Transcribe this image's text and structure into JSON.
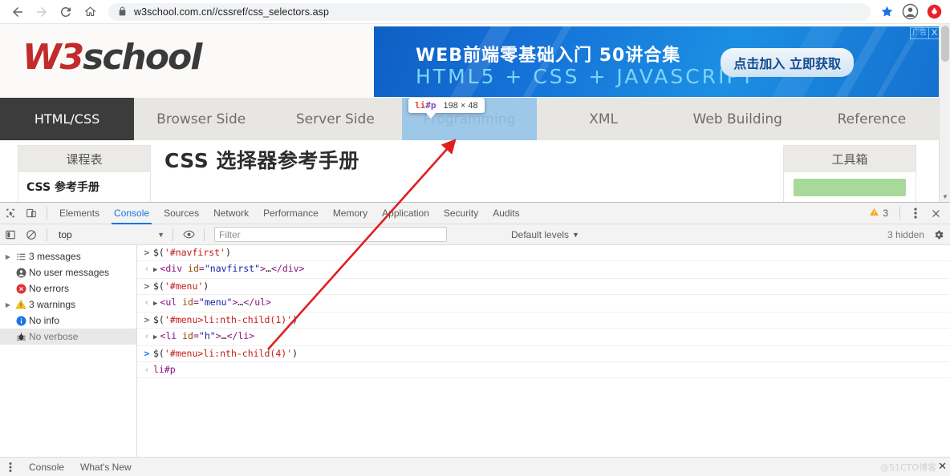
{
  "browser": {
    "back_icon": "back-arrow-icon",
    "forward_icon": "forward-arrow-icon",
    "reload_icon": "reload-icon",
    "home_icon": "home-icon",
    "lock_icon": "lock-icon",
    "url": "w3school.com.cn//cssref/css_selectors.asp",
    "star_icon": "bookmark-star-icon",
    "profile_icon": "profile-avatar-icon",
    "extension_icon": "extension-icon"
  },
  "page": {
    "logo": {
      "part1": "W3",
      "part2": "school"
    },
    "ad": {
      "title": "WEB前端零基础入门 50讲合集",
      "subtitle": "HTML5 + CSS + JAVASCRIPT",
      "cta": "点击加入 立即获取",
      "label": "广告",
      "close": "X"
    },
    "inspect_tooltip": {
      "tag": "li",
      "id": "#p",
      "dimensions": "198 × 48"
    },
    "nav": [
      {
        "label": "HTML/CSS",
        "state": "active"
      },
      {
        "label": "Browser Side",
        "state": "normal"
      },
      {
        "label": "Server Side",
        "state": "normal"
      },
      {
        "label": "Programming",
        "state": "highlighted"
      },
      {
        "label": "XML",
        "state": "normal"
      },
      {
        "label": "Web Building",
        "state": "normal"
      },
      {
        "label": "Reference",
        "state": "normal"
      }
    ],
    "left_panel": {
      "header": "课程表",
      "item": "CSS 参考手册"
    },
    "title": "CSS 选择器参考手册",
    "right_panel": {
      "header": "工具箱"
    }
  },
  "devtools": {
    "inspect_icon": "inspect-element-icon",
    "device_icon": "device-toolbar-icon",
    "tabs": [
      {
        "label": "Elements",
        "active": false
      },
      {
        "label": "Console",
        "active": true
      },
      {
        "label": "Sources",
        "active": false
      },
      {
        "label": "Network",
        "active": false
      },
      {
        "label": "Performance",
        "active": false
      },
      {
        "label": "Memory",
        "active": false
      },
      {
        "label": "Application",
        "active": false
      },
      {
        "label": "Security",
        "active": false
      },
      {
        "label": "Audits",
        "active": false
      }
    ],
    "warning_count": "3",
    "warning_icon": "warning-triangle-icon",
    "kebab_icon": "more-options-icon",
    "close_icon": "close-icon",
    "filterbar": {
      "sidebar_toggle_icon": "console-sidebar-toggle-icon",
      "clear_icon": "clear-console-icon",
      "context": "top",
      "eye_icon": "live-expression-icon",
      "filter_placeholder": "Filter",
      "levels": "Default levels",
      "hidden": "3 hidden",
      "settings_icon": "settings-gear-icon"
    },
    "sidebar": [
      {
        "label": "3 messages",
        "icon": "messages-list-icon",
        "expandable": true,
        "selected": false
      },
      {
        "label": "No user messages",
        "icon": "user-message-icon",
        "expandable": false,
        "selected": false
      },
      {
        "label": "No errors",
        "icon": "error-circle-icon",
        "expandable": false,
        "selected": false
      },
      {
        "label": "3 warnings",
        "icon": "warning-triangle-icon",
        "expandable": true,
        "selected": false
      },
      {
        "label": "No info",
        "icon": "info-circle-icon",
        "expandable": false,
        "selected": false
      },
      {
        "label": "No verbose",
        "icon": "verbose-bug-icon",
        "expandable": false,
        "selected": true
      }
    ],
    "console_lines": [
      {
        "kind": "input",
        "active": false,
        "text": "$('#navfirst')"
      },
      {
        "kind": "output",
        "disclosure": true,
        "text": "<div id=\"navfirst\">…</div>"
      },
      {
        "kind": "input",
        "active": false,
        "text": "$('#menu')"
      },
      {
        "kind": "output",
        "disclosure": true,
        "text": "<ul id=\"menu\">…</ul>"
      },
      {
        "kind": "input",
        "active": false,
        "text": "$('#menu>li:nth-child(1)')"
      },
      {
        "kind": "output",
        "disclosure": true,
        "text": "<li id=\"h\">…</li>"
      },
      {
        "kind": "input",
        "active": true,
        "text": "$('#menu>li:nth-child(4)')"
      },
      {
        "kind": "result",
        "disclosure": false,
        "text": "li#p"
      }
    ],
    "drawer": {
      "kebab_icon": "drawer-more-icon",
      "tabs": [
        {
          "label": "Console"
        },
        {
          "label": "What's New"
        }
      ]
    },
    "watermark": {
      "text": "@51CTO博客",
      "close": "✕"
    }
  },
  "annotation": {
    "type": "red-arrow",
    "color": "#e02020"
  }
}
